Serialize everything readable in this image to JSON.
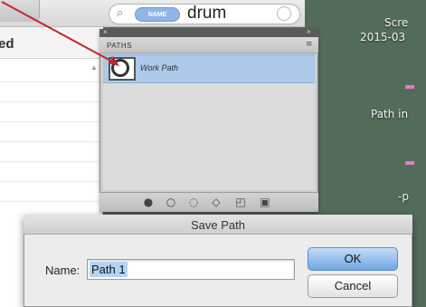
{
  "finder": {
    "search_token": "NAME",
    "search_query": "drum",
    "sidebar_heading": "ed"
  },
  "desktop": {
    "label_1": "Scre",
    "label_2": "2015-03",
    "label_3": "Path in",
    "label_4": "-p"
  },
  "paths_panel": {
    "tab_label": "PATHS",
    "items": [
      {
        "name": "Work Path",
        "selected": true
      }
    ]
  },
  "save_dialog": {
    "title": "Save Path",
    "name_label": "Name:",
    "name_value": "Path 1",
    "ok_label": "OK",
    "cancel_label": "Cancel"
  },
  "colors": {
    "selection": "#acc9ea",
    "annotation_arrow": "#c0272d",
    "default_button": "#6fa6e3",
    "desktop": "#536c5a"
  },
  "icons": [
    "search-icon",
    "clear-search-icon",
    "fill-path-icon",
    "stroke-path-icon",
    "load-selection-icon",
    "make-mask-icon",
    "new-path-icon",
    "delete-path-icon",
    "panel-menu-icon",
    "panel-close-icon",
    "panel-collapse-icon"
  ]
}
